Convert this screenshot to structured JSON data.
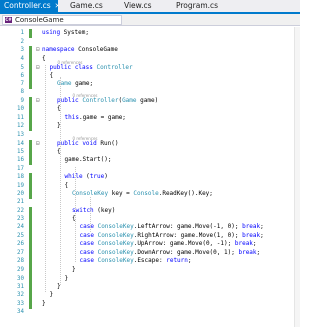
{
  "tabs": [
    {
      "label": "Controller.cs",
      "active": true,
      "close": "✕"
    },
    {
      "label": "Game.cs",
      "active": false
    },
    {
      "label": "View.cs",
      "active": false
    },
    {
      "label": "Program.cs",
      "active": false
    }
  ],
  "nav": {
    "dropdown_label": "ConsoleGame",
    "icon": "C#"
  },
  "colors": {
    "keyword": "#0000ff",
    "type": "#2b91af",
    "linenumber": "#2b91af",
    "change_bar": "#57a64a",
    "accent": "#007acc"
  },
  "codelens": [
    "0 references",
    "0 references",
    "0 references"
  ],
  "lines": [
    {
      "n": "1",
      "text": "using System;"
    },
    {
      "n": "2",
      "text": ""
    },
    {
      "n": "3",
      "text": "namespace ConsoleGame"
    },
    {
      "n": "4",
      "text": "{"
    },
    {
      "n": "5",
      "text": "public class Controller"
    },
    {
      "n": "6",
      "text": "{"
    },
    {
      "n": "7",
      "text": "Game game;"
    },
    {
      "n": "8",
      "text": ""
    },
    {
      "n": "9",
      "text": "public Controller(Game game)"
    },
    {
      "n": "10",
      "text": "{"
    },
    {
      "n": "11",
      "text": "this.game = game;"
    },
    {
      "n": "12",
      "text": "}"
    },
    {
      "n": "13",
      "text": ""
    },
    {
      "n": "14",
      "text": "public void Run()"
    },
    {
      "n": "15",
      "text": "{"
    },
    {
      "n": "16",
      "text": "game.Start();"
    },
    {
      "n": "17",
      "text": ""
    },
    {
      "n": "18",
      "text": "while (true)"
    },
    {
      "n": "19",
      "text": "{"
    },
    {
      "n": "20",
      "text": "ConsoleKey key = Console.ReadKey().Key;"
    },
    {
      "n": "21",
      "text": ""
    },
    {
      "n": "22",
      "text": "switch (key)"
    },
    {
      "n": "23",
      "text": "{"
    },
    {
      "n": "24",
      "text": "case ConsoleKey.LeftArrow: game.Move(-1, 0); break;"
    },
    {
      "n": "25",
      "text": "case ConsoleKey.RightArrow: game.Move(1, 0); break;"
    },
    {
      "n": "26",
      "text": "case ConsoleKey.UpArrow: game.Move(0, -1); break;"
    },
    {
      "n": "27",
      "text": "case ConsoleKey.DownArrow: game.Move(0, 1); break;"
    },
    {
      "n": "28",
      "text": "case ConsoleKey.Escape: return;"
    },
    {
      "n": "29",
      "text": "}"
    },
    {
      "n": "30",
      "text": "}"
    },
    {
      "n": "31",
      "text": "}"
    },
    {
      "n": "32",
      "text": "}"
    },
    {
      "n": "33",
      "text": "}"
    },
    {
      "n": "34",
      "text": ""
    }
  ]
}
